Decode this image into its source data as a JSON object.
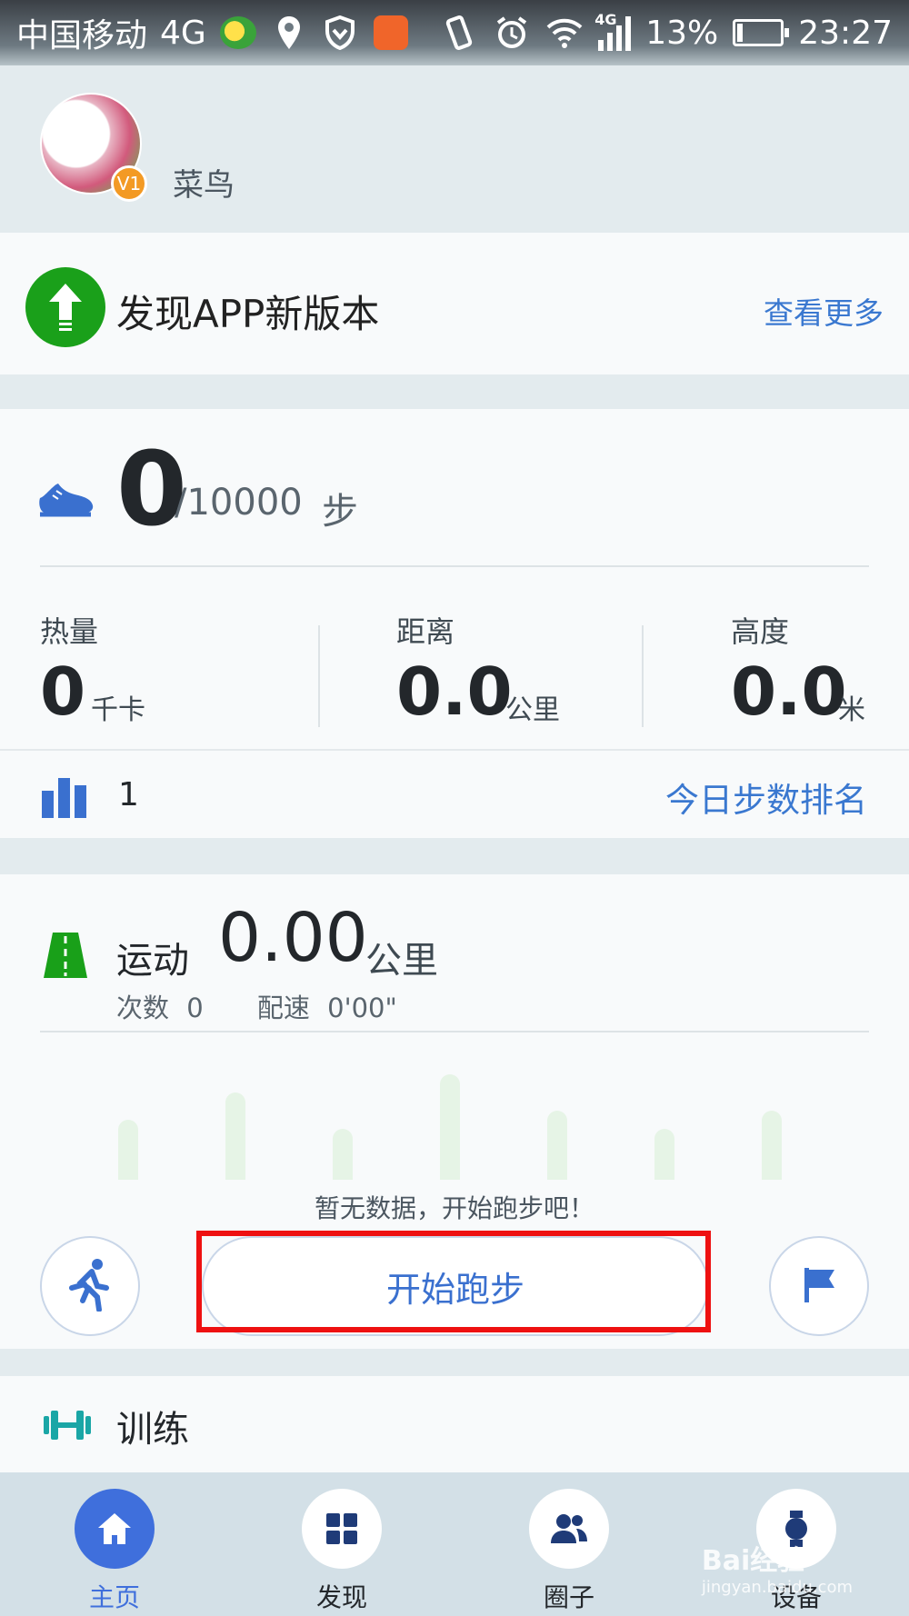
{
  "status_bar": {
    "carrier": "中国移动",
    "network": "4G",
    "signal_label": "4G",
    "battery_percent": "13%",
    "battery_level": 0.13,
    "time": "23:27"
  },
  "profile": {
    "username": "菜鸟",
    "level_badge": "V1"
  },
  "update_banner": {
    "title": "发现APP新版本",
    "link": "查看更多"
  },
  "steps": {
    "count": "0",
    "goal": "/10000",
    "unit": "步",
    "stats": [
      {
        "label": "热量",
        "value": "0",
        "unit": "千卡"
      },
      {
        "label": "距离",
        "value": "0.0",
        "unit": "公里"
      },
      {
        "label": "高度",
        "value": "0.0",
        "unit": "米"
      }
    ],
    "rank": "1",
    "rank_link": "今日步数排名"
  },
  "sport": {
    "label": "运动",
    "distance": "0.00",
    "unit": "公里",
    "count_label": "次数",
    "count_value": "0",
    "pace_label": "配速",
    "pace_value": "0'00\"",
    "empty_message": "暂无数据，开始跑步吧！",
    "start_button": "开始跑步"
  },
  "training": {
    "label": "训练"
  },
  "tabs": [
    {
      "label": "主页",
      "icon": "home-icon",
      "active": true
    },
    {
      "label": "发现",
      "icon": "grid-icon",
      "active": false
    },
    {
      "label": "圈子",
      "icon": "people-icon",
      "active": false
    },
    {
      "label": "设备",
      "icon": "watch-icon",
      "active": false
    }
  ],
  "watermark": {
    "text": "Bai经验",
    "url": "jingyan.baidu.com"
  },
  "colors": {
    "accent": "#3a78d0",
    "active_tab": "#3f6fdc",
    "update_green": "#1aa01a",
    "highlight_red": "#ee1111"
  }
}
